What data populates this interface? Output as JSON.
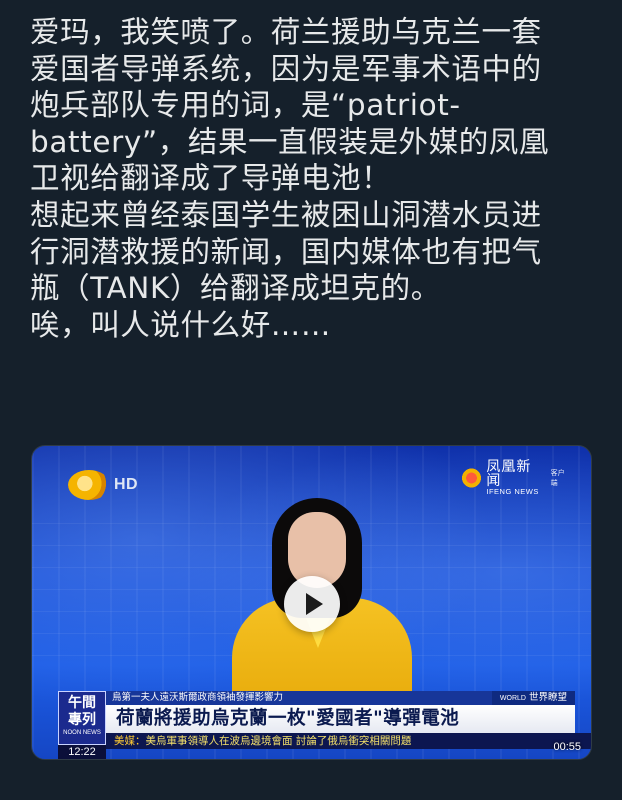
{
  "post": {
    "text": "爱玛，我笑喷了。荷兰援助乌克兰一套\n爱国者导弹系统，因为是军事术语中的\n炮兵部队专用的词，是“patriot-\nbattery”，结果一直假装是外媒的凤凰\n卫视给翻译成了导弹电池！\n想起来曾经泰国学生被困山洞潜水员进\n行洞潜救援的新闻，国内媒体也有把气\n瓶（TANK）给翻译成坦克的。\n唉，叫人说什么好……"
  },
  "video": {
    "left_logo_text": "HD",
    "right_logo_zh": "凤凰新闻",
    "right_logo_en": "IFENG NEWS",
    "right_logo_sub": "客户端",
    "badge_line1": "午間",
    "badge_line2": "專列",
    "badge_line3": "NOON NEWS",
    "time": "12:22",
    "top_strip": "烏第一夫人遠沃斯爾政商領袖發揮影響力",
    "world_en": "WORLD",
    "world_zh": "世界瞭望",
    "headline": "荷蘭將援助烏克蘭一枚\"愛國者\"導彈電池",
    "bottom_source": "美媒：",
    "bottom_text": "美烏軍事領導人在波烏邊境會面 討論了俄烏衝突相關問題",
    "duration": "00:55",
    "play_icon": "play-icon"
  }
}
